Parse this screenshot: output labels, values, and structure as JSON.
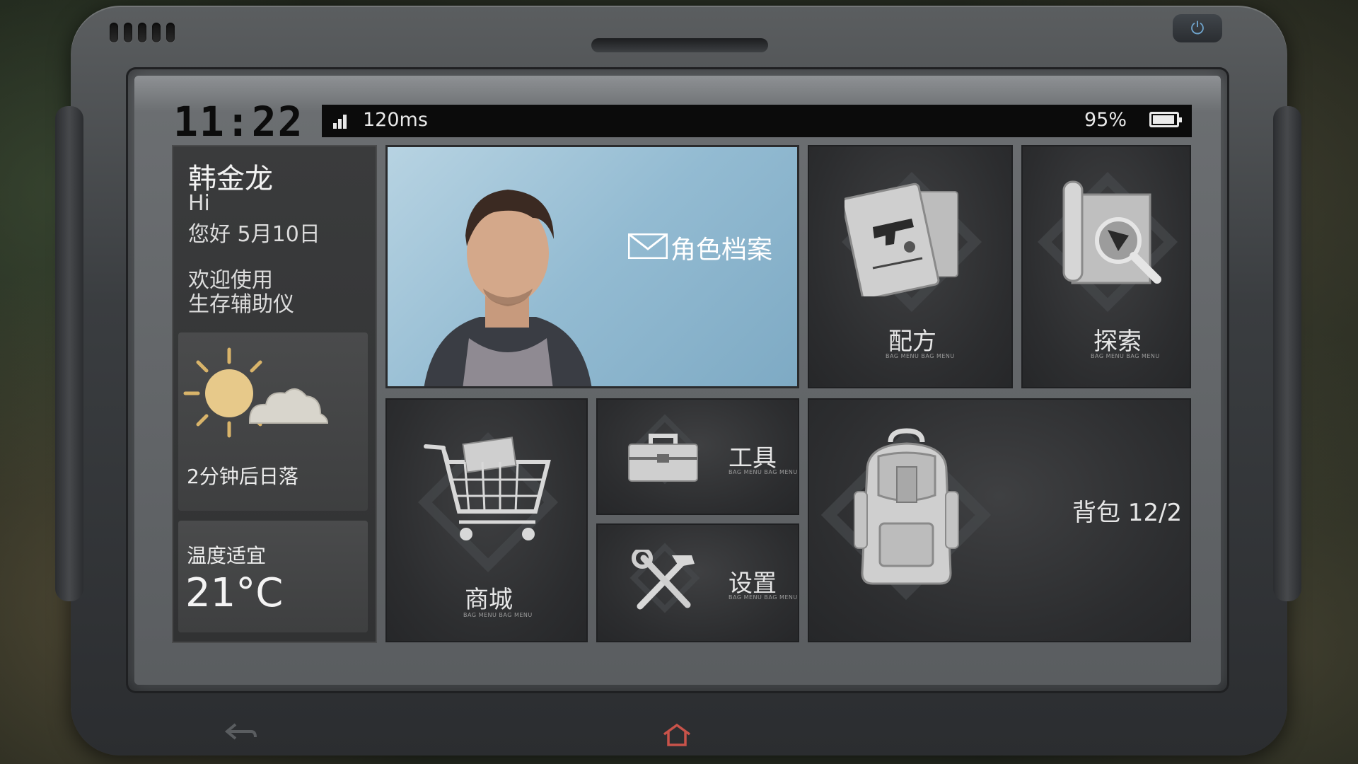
{
  "status": {
    "clock": "11:22",
    "ping": "120ms",
    "battery": "95%",
    "battery_level": 0.95
  },
  "greeting": {
    "name": "韩金龙",
    "hi": "Hi",
    "date_line": "您好 5月10日",
    "welcome_line1": "欢迎使用",
    "welcome_line2": "生存辅助仪"
  },
  "weather": {
    "sunset_text": "2分钟后日落",
    "temp_label": "温度适宜",
    "temp_value": "21°C"
  },
  "tiles": {
    "profile": {
      "label": "角色档案"
    },
    "recipe": {
      "label": "配方",
      "sub": "BAG MENU BAG MENU"
    },
    "explore": {
      "label": "探索",
      "sub": "BAG MENU BAG MENU"
    },
    "shop": {
      "label": "商城",
      "sub": "BAG MENU BAG MENU"
    },
    "tools": {
      "label": "工具",
      "sub": "BAG MENU BAG MENU"
    },
    "settings": {
      "label": "设置",
      "sub": "BAG MENU BAG MENU"
    },
    "backpack": {
      "label": "背包 12/2"
    }
  },
  "colors": {
    "accent_blue": "#6fa4cc",
    "home_red": "#c9534a"
  },
  "icons": [
    "signal-icon",
    "battery-icon",
    "sun-cloud-icon",
    "mail-icon",
    "recipe-book-icon",
    "explore-map-icon",
    "shopping-cart-icon",
    "toolbox-icon",
    "wrench-hammer-icon",
    "backpack-icon",
    "home-icon",
    "back-icon",
    "power-icon"
  ]
}
